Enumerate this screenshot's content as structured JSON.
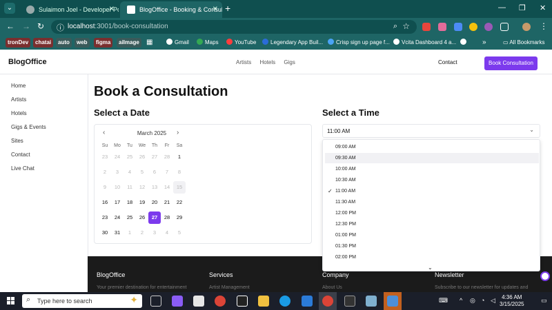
{
  "browser": {
    "tabs": [
      {
        "title": "Sulaimon Joel - Developer Portf",
        "active": false
      },
      {
        "title": "BlogOffice - Booking & Consulta",
        "active": true
      }
    ],
    "url_host": "localhost",
    "url_path": ":3001/book-consultation",
    "bookmarks": [
      "tronDev",
      "chatai",
      "auto",
      "web",
      "figma",
      "aiImage",
      "Gmail",
      "Maps",
      "YouTube",
      "Legendary App Buil...",
      "Crisp sign up page f...",
      "Vcita Dashboard 4 a...",
      "All Bookmarks"
    ]
  },
  "site": {
    "brand": "BlogOffice",
    "nav": [
      "Artists",
      "Hotels",
      "Gigs"
    ],
    "contact": "Contact",
    "cta": "Book Consultation",
    "sidebar": [
      "Home",
      "Artists",
      "Hotels",
      "Gigs & Events",
      "Sites",
      "Contact",
      "Live Chat"
    ]
  },
  "main": {
    "title": "Book a Consultation",
    "date_heading": "Select a Date",
    "time_heading": "Select a Time",
    "calendar": {
      "month": "March 2025",
      "weekdays": [
        "Su",
        "Mo",
        "Tu",
        "We",
        "Th",
        "Fr",
        "Sa"
      ],
      "weeks": [
        [
          "23",
          "24",
          "25",
          "26",
          "27",
          "28",
          "1"
        ],
        [
          "2",
          "3",
          "4",
          "5",
          "6",
          "7",
          "8"
        ],
        [
          "9",
          "10",
          "11",
          "12",
          "13",
          "14",
          "15"
        ],
        [
          "16",
          "17",
          "18",
          "19",
          "20",
          "21",
          "22"
        ],
        [
          "23",
          "24",
          "25",
          "26",
          "27",
          "28",
          "29"
        ],
        [
          "30",
          "31",
          "1",
          "2",
          "3",
          "4",
          "5"
        ]
      ],
      "selected_day": "27",
      "today": "15"
    },
    "time": {
      "selected": "11:00 AM",
      "options": [
        "09:00 AM",
        "09:30 AM",
        "10:00 AM",
        "10:30 AM",
        "11:00 AM",
        "11:30 AM",
        "12:00 PM",
        "12:30 PM",
        "01:00 PM",
        "01:30 PM",
        "02:00 PM"
      ],
      "highlighted": "09:30 AM"
    }
  },
  "footer": {
    "columns": [
      {
        "heading": "BlogOffice",
        "text": "Your premier destination for entertainment"
      },
      {
        "heading": "Services",
        "text": "Artist Management"
      },
      {
        "heading": "Company",
        "text": "About Us"
      },
      {
        "heading": "Newsletter",
        "text": "Subscribe to our newsletter for updates and"
      }
    ]
  },
  "taskbar": {
    "search_placeholder": "Type here to search",
    "time": "4:36 AM",
    "date": "3/15/2025"
  },
  "colors": {
    "accent": "#7c3aed",
    "chrome": "#1e6565",
    "footer": "#1b1b1b"
  }
}
